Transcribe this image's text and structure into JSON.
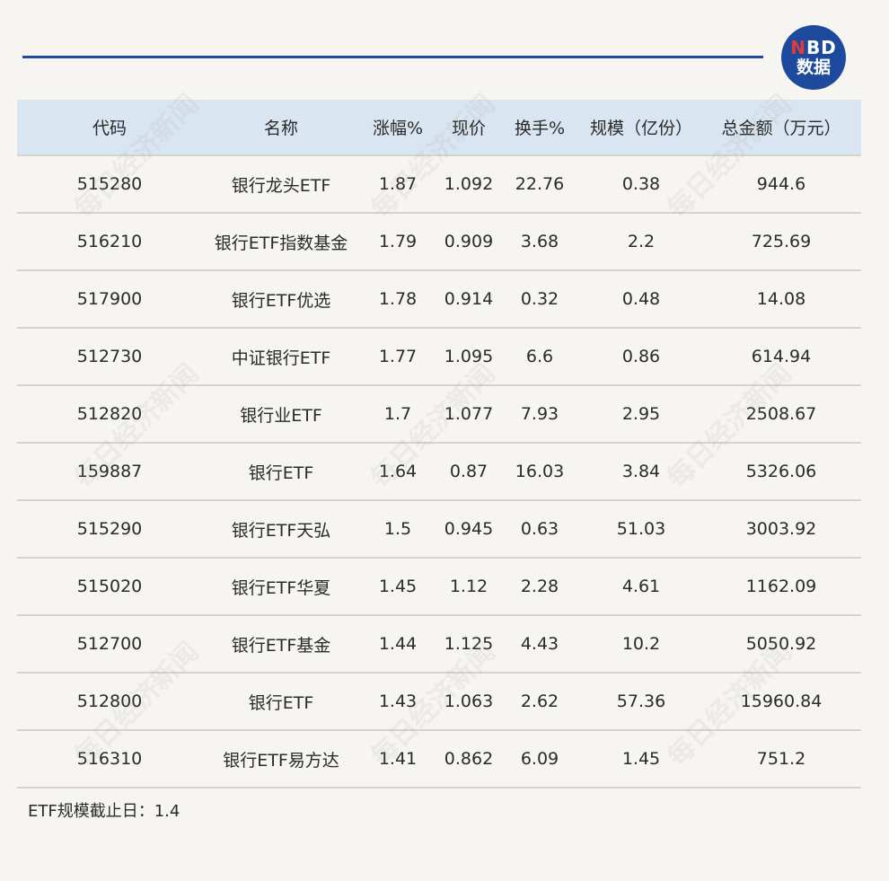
{
  "logo": {
    "line1_n": "N",
    "line1_rest": "BD",
    "line2": "数据"
  },
  "watermark_text": "每日经济新闻",
  "table": {
    "headers": [
      "代码",
      "名称",
      "涨幅%",
      "现价",
      "换手%",
      "规模（亿份）",
      "总金额（万元）"
    ],
    "rows": [
      [
        "515280",
        "银行龙头ETF",
        "1.87",
        "1.092",
        "22.76",
        "0.38",
        "944.6"
      ],
      [
        "516210",
        "银行ETF指数基金",
        "1.79",
        "0.909",
        "3.68",
        "2.2",
        "725.69"
      ],
      [
        "517900",
        "银行ETF优选",
        "1.78",
        "0.914",
        "0.32",
        "0.48",
        "14.08"
      ],
      [
        "512730",
        "中证银行ETF",
        "1.77",
        "1.095",
        "6.6",
        "0.86",
        "614.94"
      ],
      [
        "512820",
        "银行业ETF",
        "1.7",
        "1.077",
        "7.93",
        "2.95",
        "2508.67"
      ],
      [
        "159887",
        "银行ETF",
        "1.64",
        "0.87",
        "16.03",
        "3.84",
        "5326.06"
      ],
      [
        "515290",
        "银行ETF天弘",
        "1.5",
        "0.945",
        "0.63",
        "51.03",
        "3003.92"
      ],
      [
        "515020",
        "银行ETF华夏",
        "1.45",
        "1.12",
        "2.28",
        "4.61",
        "1162.09"
      ],
      [
        "512700",
        "银行ETF基金",
        "1.44",
        "1.125",
        "4.43",
        "10.2",
        "5050.92"
      ],
      [
        "512800",
        "银行ETF",
        "1.43",
        "1.063",
        "2.62",
        "57.36",
        "15960.84"
      ],
      [
        "516310",
        "银行ETF易方达",
        "1.41",
        "0.862",
        "6.09",
        "1.45",
        "751.2"
      ]
    ]
  },
  "footnote": "ETF规模截止日：1.4",
  "colors": {
    "accent": "#1f4aa0",
    "header_bg": "#d9e5f1",
    "page_bg": "#f7f5f1",
    "logo_n": "#e23a3a"
  }
}
